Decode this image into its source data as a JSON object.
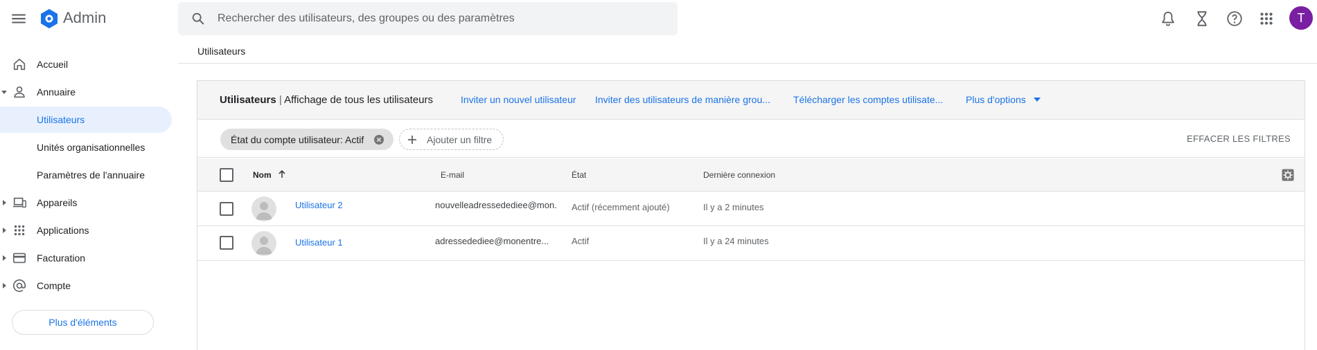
{
  "header": {
    "app_title": "Admin",
    "search_placeholder": "Rechercher des utilisateurs, des groupes ou des paramètres",
    "avatar_letter": "T",
    "avatar_color": "#7b1fa2",
    "icons": [
      "menu-icon",
      "admin-logo-icon",
      "search-icon",
      "bell-icon",
      "hourglass-icon",
      "help-icon",
      "apps-grid-icon"
    ]
  },
  "breadcrumb": "Utilisateurs",
  "sidebar": {
    "items": [
      {
        "label": "Accueil",
        "icon": "home-icon"
      },
      {
        "label": "Annuaire",
        "icon": "person-icon",
        "expanded": true
      },
      {
        "label": "Utilisateurs",
        "active": true
      },
      {
        "label": "Unités organisationnelles"
      },
      {
        "label": "Paramètres de l'annuaire"
      },
      {
        "label": "Appareils",
        "icon": "devices-icon"
      },
      {
        "label": "Applications",
        "icon": "apps-icon"
      },
      {
        "label": "Facturation",
        "icon": "credit-card-icon"
      },
      {
        "label": "Compte",
        "icon": "at-sign-icon"
      }
    ],
    "more_button": "Plus d'éléments"
  },
  "toolbar": {
    "title_bold": "Utilisateurs",
    "title_sep": " | ",
    "title_rest": "Affichage de tous les utilisateurs",
    "links": [
      "Inviter un nouvel utilisateur",
      "Inviter des utilisateurs de manière grou...",
      "Télécharger les comptes utilisate...",
      "Plus d'options"
    ]
  },
  "filters": {
    "chip": "État du compte utilisateur: Actif",
    "add_filter": "Ajouter un filtre",
    "clear": "EFFACER LES FILTRES"
  },
  "table": {
    "columns": [
      "Nom",
      "E-mail",
      "État",
      "Dernière connexion"
    ],
    "rows": [
      {
        "name": "Utilisateur 2",
        "email": "nouvelleadressedediee@mon...",
        "status": "Actif (récemment ajouté)",
        "last_login": "Il y a 2 minutes"
      },
      {
        "name": "Utilisateur 1",
        "email": "adressedediee@monentre...",
        "status": "Actif",
        "last_login": "Il y a 24 minutes"
      }
    ]
  },
  "colors": {
    "accent": "#1a73e8",
    "active_bg": "#e8f0fe",
    "toolbar_bg": "#f5f5f5"
  }
}
